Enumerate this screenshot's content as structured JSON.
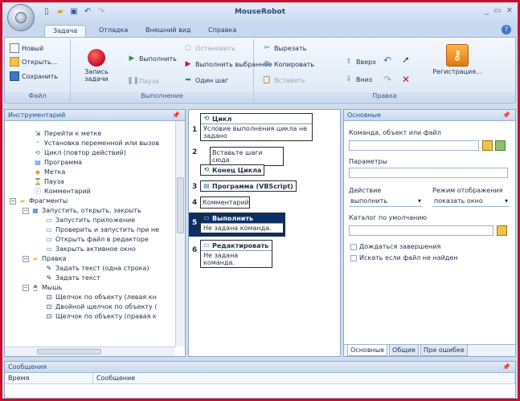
{
  "app": {
    "title": "MouseRobot"
  },
  "ribbon": {
    "tabs": [
      "Задача",
      "Отладка",
      "Внешний вид",
      "Справка"
    ],
    "file": {
      "label": "Файл",
      "new": "Новый",
      "open": "Открыть...",
      "save": "Сохранить"
    },
    "exec": {
      "label": "Выполнение",
      "record": "Запись задачи",
      "pause": "Пауза",
      "run": "Выполнить",
      "stop": "Остановить",
      "run_selected": "Выполнить выбранное",
      "one_step": "Один шаг"
    },
    "edit": {
      "label": "Правка",
      "cut": "Вырезать",
      "copy": "Копировать",
      "paste": "Вставить",
      "up": "Вверх",
      "down": "Вниз",
      "register": "Регистрация..."
    }
  },
  "tools": {
    "title": "Инструментарий",
    "items": [
      "Перейти к метке",
      "Установка переменной или вызов",
      "Цикл (повтор действий)",
      "Программа",
      "Метка",
      "Пауза",
      "Комментарий",
      "Фрагменты",
      "Запустить, открыть, закрыть",
      "Запустить приложение",
      "Проверить и запустить при не",
      "Открыть файл в редакторе",
      "Закрыть активное окно",
      "Правка",
      "Задать текст (одна строка)",
      "Задать текст",
      "Мышь",
      "Щелчок по объекту (левая кн",
      "Двойной щелчок по объекту (",
      "Щелчок по объекту (правая к"
    ]
  },
  "script": {
    "steps": [
      {
        "num": "1",
        "title": "Цикл",
        "body": "Условие выполнения цикла не задано"
      },
      {
        "num": "2",
        "title": "",
        "body": "Вставьте шаги сюда"
      },
      {
        "num": "",
        "title": "Конец Цикла",
        "body": ""
      },
      {
        "num": "3",
        "title": "Программа (VBScript)",
        "body": ""
      },
      {
        "num": "4",
        "title": "",
        "body": "Комментарий"
      },
      {
        "num": "5",
        "title": "Выполнить",
        "body": "Не задана команда."
      },
      {
        "num": "6",
        "title": "Редактировать",
        "body": "Не задана команда."
      }
    ]
  },
  "props": {
    "title": "Основные",
    "command_label": "Команда, объект или файл",
    "params_label": "Параметры",
    "action_label": "Действие",
    "action_value": "выполнить",
    "display_label": "Режим отображения",
    "display_value": "показать окно",
    "dir_label": "Каталог по умолчанию",
    "wait_label": "Дождаться завершения",
    "search_label": "Искать если файл не найден",
    "tabs": [
      "Основные",
      "Общие",
      "При ошибке"
    ]
  },
  "messages": {
    "title": "Сообщения",
    "columns": [
      "Время",
      "Сообщение"
    ]
  },
  "colors": {
    "accent": "#c8102e",
    "selection": "#0b2f62"
  }
}
